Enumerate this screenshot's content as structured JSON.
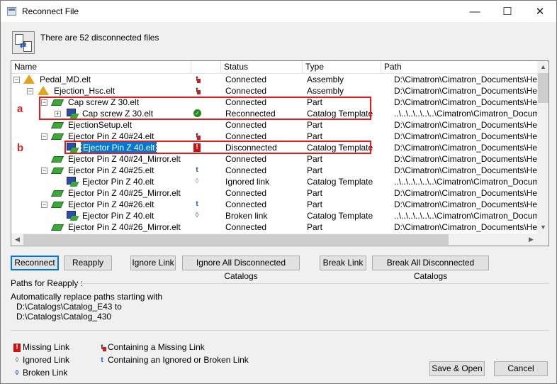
{
  "window": {
    "title": "Reconnect File",
    "minimize": "—",
    "maximize": "☐",
    "close": "✕"
  },
  "header": {
    "info": "There are 52 disconnected files"
  },
  "tree": {
    "columns": [
      "Name",
      "",
      "Status",
      "Type",
      "Path"
    ],
    "rows": [
      {
        "name": "Pedal_MD.elt",
        "status": "Connected",
        "type": "Assembly",
        "path": "D:\\Cimatron\\Cimatron_Documents\\Help W",
        "icon": "assembly",
        "status_icon": "containing-missing"
      },
      {
        "name": "Ejection_Hsc.elt",
        "status": "Connected",
        "type": "Assembly",
        "path": "D:\\Cimatron\\Cimatron_Documents\\Help W",
        "icon": "assembly",
        "status_icon": "containing-missing"
      },
      {
        "name": "Cap screw Z 30.elt",
        "status": "Connected",
        "type": "Part",
        "path": "D:\\Cimatron\\Cimatron_Documents\\Help W",
        "icon": "part",
        "status_icon": ""
      },
      {
        "name": "Cap screw Z 30.elt",
        "status": "Reconnected",
        "type": "Catalog Template",
        "path": "..\\..\\..\\..\\..\\..\\Cimatron\\Cimatron_Documents\\Help W",
        "icon": "catalog",
        "status_icon": "reconnected"
      },
      {
        "name": "EjectionSetup.elt",
        "status": "Connected",
        "type": "Part",
        "path": "D:\\Cimatron\\Cimatron_Documents\\Help W",
        "icon": "part",
        "status_icon": ""
      },
      {
        "name": "Ejector Pin Z 40#24.elt",
        "status": "Connected",
        "type": "Part",
        "path": "D:\\Cimatron\\Cimatron_Documents\\Help W",
        "icon": "part",
        "status_icon": "containing-missing"
      },
      {
        "name": "Ejector Pin Z 40.elt",
        "status": "Disconnected",
        "type": "Catalog Template",
        "path": "D:\\Cimatron\\Cimatron_Documents\\Help W",
        "icon": "catalog",
        "status_icon": "missing"
      },
      {
        "name": "Ejector Pin Z 40#24_Mirror.elt",
        "status": "Connected",
        "type": "Part",
        "path": "D:\\Cimatron\\Cimatron_Documents\\Help W",
        "icon": "part",
        "status_icon": ""
      },
      {
        "name": "Ejector Pin Z 40#25.elt",
        "status": "Connected",
        "type": "Part",
        "path": "D:\\Cimatron\\Cimatron_Documents\\Help W",
        "icon": "part",
        "status_icon": "containing-ignored"
      },
      {
        "name": "Ejector Pin Z 40.elt",
        "status": "Ignored link",
        "type": "Catalog Template",
        "path": "..\\..\\..\\..\\..\\..\\Cimatron\\Cimatron_Documents\\Help W",
        "icon": "catalog",
        "status_icon": "ignored"
      },
      {
        "name": "Ejector Pin Z 40#25_Mirror.elt",
        "status": "Connected",
        "type": "Part",
        "path": "D:\\Cimatron\\Cimatron_Documents\\Help W",
        "icon": "part",
        "status_icon": ""
      },
      {
        "name": "Ejector Pin Z 40#26.elt",
        "status": "Connected",
        "type": "Part",
        "path": "D:\\Cimatron\\Cimatron_Documents\\Help W",
        "icon": "part",
        "status_icon": "containing-ignored"
      },
      {
        "name": "Ejector Pin Z 40.elt",
        "status": "Broken link",
        "type": "Catalog Template",
        "path": "..\\..\\..\\..\\..\\..\\Cimatron\\Cimatron_Documents\\Help W",
        "icon": "catalog",
        "status_icon": "broken"
      },
      {
        "name": "Ejector Pin Z 40#26_Mirror.elt",
        "status": "Connected",
        "type": "Part",
        "path": "D:\\Cimatron\\Cimatron_Documents\\Help W",
        "icon": "part",
        "status_icon": ""
      }
    ],
    "annotation_a": "a",
    "annotation_b": "b"
  },
  "buttons": {
    "reconnect": "Reconnect",
    "reapply": "Reapply",
    "ignore_link": "Ignore Link",
    "ignore_all": "Ignore All Disconnected Catalogs",
    "break_link": "Break Link",
    "break_all": "Break All Disconnected Catalogs",
    "save_open": "Save & Open",
    "cancel": "Cancel"
  },
  "reapply": {
    "label": "Paths for Reapply :",
    "line1": "Automatically replace paths starting with",
    "line2": "D:\\Catalogs\\Catalog_E43 to",
    "line3": "D:\\Catalogs\\Catalog_430"
  },
  "legend": {
    "missing": "Missing Link",
    "ignored": "Ignored Link",
    "broken": "Broken Link",
    "containing_missing": "Containing a Missing Link",
    "containing_ignored": "Containing an Ignored or Broken Link"
  },
  "colors": {
    "selection": "#0078d7",
    "annotation": "#e01e1e"
  }
}
